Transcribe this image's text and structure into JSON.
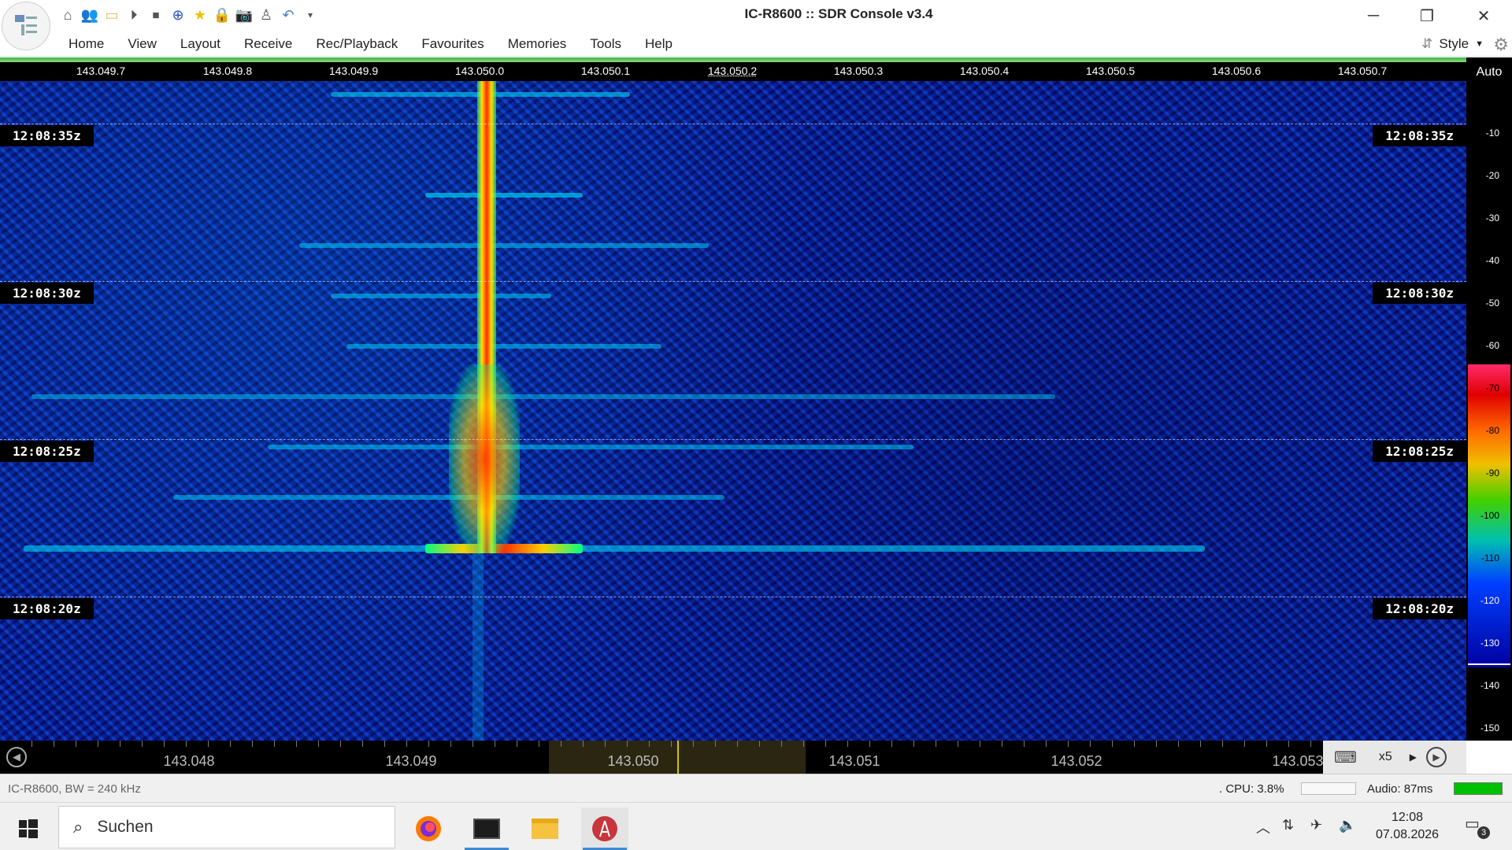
{
  "window": {
    "title": "IC-R8600 :: SDR Console v3.4"
  },
  "quick_access": [
    "home-icon",
    "users-icon",
    "folder-icon",
    "play-icon",
    "stop-icon",
    "add-icon",
    "favourite-star-icon",
    "lock-icon",
    "camera-icon",
    "satellite-icon",
    "undo-icon",
    "dropdown-icon"
  ],
  "menu": [
    "Home",
    "View",
    "Layout",
    "Receive",
    "Rec/Playback",
    "Favourites",
    "Memories",
    "Tools",
    "Help"
  ],
  "style_label": "Style",
  "top_freq_ticks": [
    "143.049.7",
    "143.049.8",
    "143.049.9",
    "143.050.0",
    "143.050.1",
    "143.050.2",
    "143.050.3",
    "143.050.4",
    "143.050.5",
    "143.050.6",
    "143.050.7"
  ],
  "timestamps": [
    "12:08:35z",
    "12:08:30z",
    "12:08:25z",
    "12:08:20z"
  ],
  "scale": {
    "auto_label": "Auto",
    "levels": [
      "-10",
      "-20",
      "-30",
      "-40",
      "-50",
      "-60",
      "-70",
      "-80",
      "-90",
      "-100",
      "-110",
      "-120",
      "-130",
      "-140",
      "-150"
    ]
  },
  "bottom_freq_ticks": [
    "143.048",
    "143.049",
    "143.050",
    "143.051",
    "143.052",
    "143.053"
  ],
  "zoom": "x5",
  "status": {
    "device": "IC-R8600, BW = 240 kHz",
    "cpu": ". CPU: 3.8%",
    "audio": "Audio: 87ms"
  },
  "taskbar": {
    "search_placeholder": "Suchen",
    "time": "12:08",
    "date": "07.08.2026",
    "notifications": "3"
  }
}
